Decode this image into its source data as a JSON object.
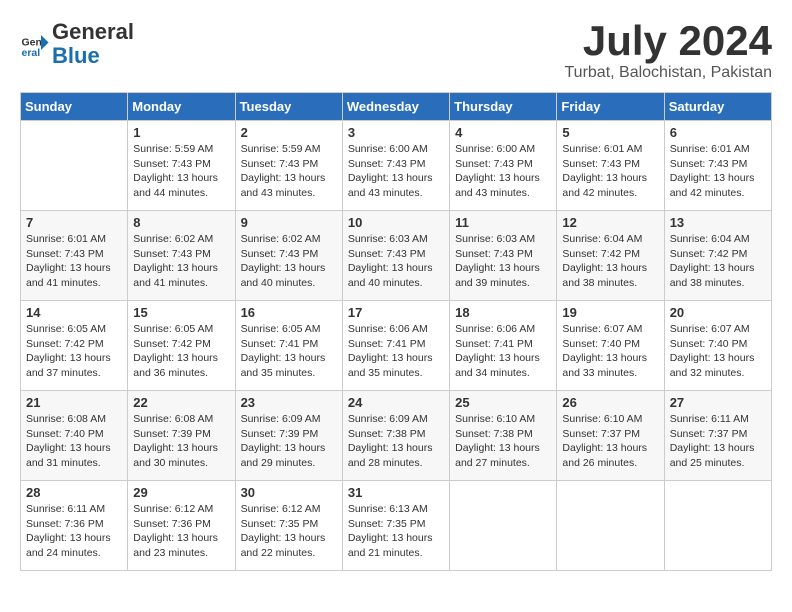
{
  "logo": {
    "general": "General",
    "blue": "Blue"
  },
  "title": "July 2024",
  "location": "Turbat, Balochistan, Pakistan",
  "headers": [
    "Sunday",
    "Monday",
    "Tuesday",
    "Wednesday",
    "Thursday",
    "Friday",
    "Saturday"
  ],
  "weeks": [
    [
      {
        "day": "",
        "info": ""
      },
      {
        "day": "1",
        "info": "Sunrise: 5:59 AM\nSunset: 7:43 PM\nDaylight: 13 hours\nand 44 minutes."
      },
      {
        "day": "2",
        "info": "Sunrise: 5:59 AM\nSunset: 7:43 PM\nDaylight: 13 hours\nand 43 minutes."
      },
      {
        "day": "3",
        "info": "Sunrise: 6:00 AM\nSunset: 7:43 PM\nDaylight: 13 hours\nand 43 minutes."
      },
      {
        "day": "4",
        "info": "Sunrise: 6:00 AM\nSunset: 7:43 PM\nDaylight: 13 hours\nand 43 minutes."
      },
      {
        "day": "5",
        "info": "Sunrise: 6:01 AM\nSunset: 7:43 PM\nDaylight: 13 hours\nand 42 minutes."
      },
      {
        "day": "6",
        "info": "Sunrise: 6:01 AM\nSunset: 7:43 PM\nDaylight: 13 hours\nand 42 minutes."
      }
    ],
    [
      {
        "day": "7",
        "info": "Sunrise: 6:01 AM\nSunset: 7:43 PM\nDaylight: 13 hours\nand 41 minutes."
      },
      {
        "day": "8",
        "info": "Sunrise: 6:02 AM\nSunset: 7:43 PM\nDaylight: 13 hours\nand 41 minutes."
      },
      {
        "day": "9",
        "info": "Sunrise: 6:02 AM\nSunset: 7:43 PM\nDaylight: 13 hours\nand 40 minutes."
      },
      {
        "day": "10",
        "info": "Sunrise: 6:03 AM\nSunset: 7:43 PM\nDaylight: 13 hours\nand 40 minutes."
      },
      {
        "day": "11",
        "info": "Sunrise: 6:03 AM\nSunset: 7:43 PM\nDaylight: 13 hours\nand 39 minutes."
      },
      {
        "day": "12",
        "info": "Sunrise: 6:04 AM\nSunset: 7:42 PM\nDaylight: 13 hours\nand 38 minutes."
      },
      {
        "day": "13",
        "info": "Sunrise: 6:04 AM\nSunset: 7:42 PM\nDaylight: 13 hours\nand 38 minutes."
      }
    ],
    [
      {
        "day": "14",
        "info": "Sunrise: 6:05 AM\nSunset: 7:42 PM\nDaylight: 13 hours\nand 37 minutes."
      },
      {
        "day": "15",
        "info": "Sunrise: 6:05 AM\nSunset: 7:42 PM\nDaylight: 13 hours\nand 36 minutes."
      },
      {
        "day": "16",
        "info": "Sunrise: 6:05 AM\nSunset: 7:41 PM\nDaylight: 13 hours\nand 35 minutes."
      },
      {
        "day": "17",
        "info": "Sunrise: 6:06 AM\nSunset: 7:41 PM\nDaylight: 13 hours\nand 35 minutes."
      },
      {
        "day": "18",
        "info": "Sunrise: 6:06 AM\nSunset: 7:41 PM\nDaylight: 13 hours\nand 34 minutes."
      },
      {
        "day": "19",
        "info": "Sunrise: 6:07 AM\nSunset: 7:40 PM\nDaylight: 13 hours\nand 33 minutes."
      },
      {
        "day": "20",
        "info": "Sunrise: 6:07 AM\nSunset: 7:40 PM\nDaylight: 13 hours\nand 32 minutes."
      }
    ],
    [
      {
        "day": "21",
        "info": "Sunrise: 6:08 AM\nSunset: 7:40 PM\nDaylight: 13 hours\nand 31 minutes."
      },
      {
        "day": "22",
        "info": "Sunrise: 6:08 AM\nSunset: 7:39 PM\nDaylight: 13 hours\nand 30 minutes."
      },
      {
        "day": "23",
        "info": "Sunrise: 6:09 AM\nSunset: 7:39 PM\nDaylight: 13 hours\nand 29 minutes."
      },
      {
        "day": "24",
        "info": "Sunrise: 6:09 AM\nSunset: 7:38 PM\nDaylight: 13 hours\nand 28 minutes."
      },
      {
        "day": "25",
        "info": "Sunrise: 6:10 AM\nSunset: 7:38 PM\nDaylight: 13 hours\nand 27 minutes."
      },
      {
        "day": "26",
        "info": "Sunrise: 6:10 AM\nSunset: 7:37 PM\nDaylight: 13 hours\nand 26 minutes."
      },
      {
        "day": "27",
        "info": "Sunrise: 6:11 AM\nSunset: 7:37 PM\nDaylight: 13 hours\nand 25 minutes."
      }
    ],
    [
      {
        "day": "28",
        "info": "Sunrise: 6:11 AM\nSunset: 7:36 PM\nDaylight: 13 hours\nand 24 minutes."
      },
      {
        "day": "29",
        "info": "Sunrise: 6:12 AM\nSunset: 7:36 PM\nDaylight: 13 hours\nand 23 minutes."
      },
      {
        "day": "30",
        "info": "Sunrise: 6:12 AM\nSunset: 7:35 PM\nDaylight: 13 hours\nand 22 minutes."
      },
      {
        "day": "31",
        "info": "Sunrise: 6:13 AM\nSunset: 7:35 PM\nDaylight: 13 hours\nand 21 minutes."
      },
      {
        "day": "",
        "info": ""
      },
      {
        "day": "",
        "info": ""
      },
      {
        "day": "",
        "info": ""
      }
    ]
  ]
}
